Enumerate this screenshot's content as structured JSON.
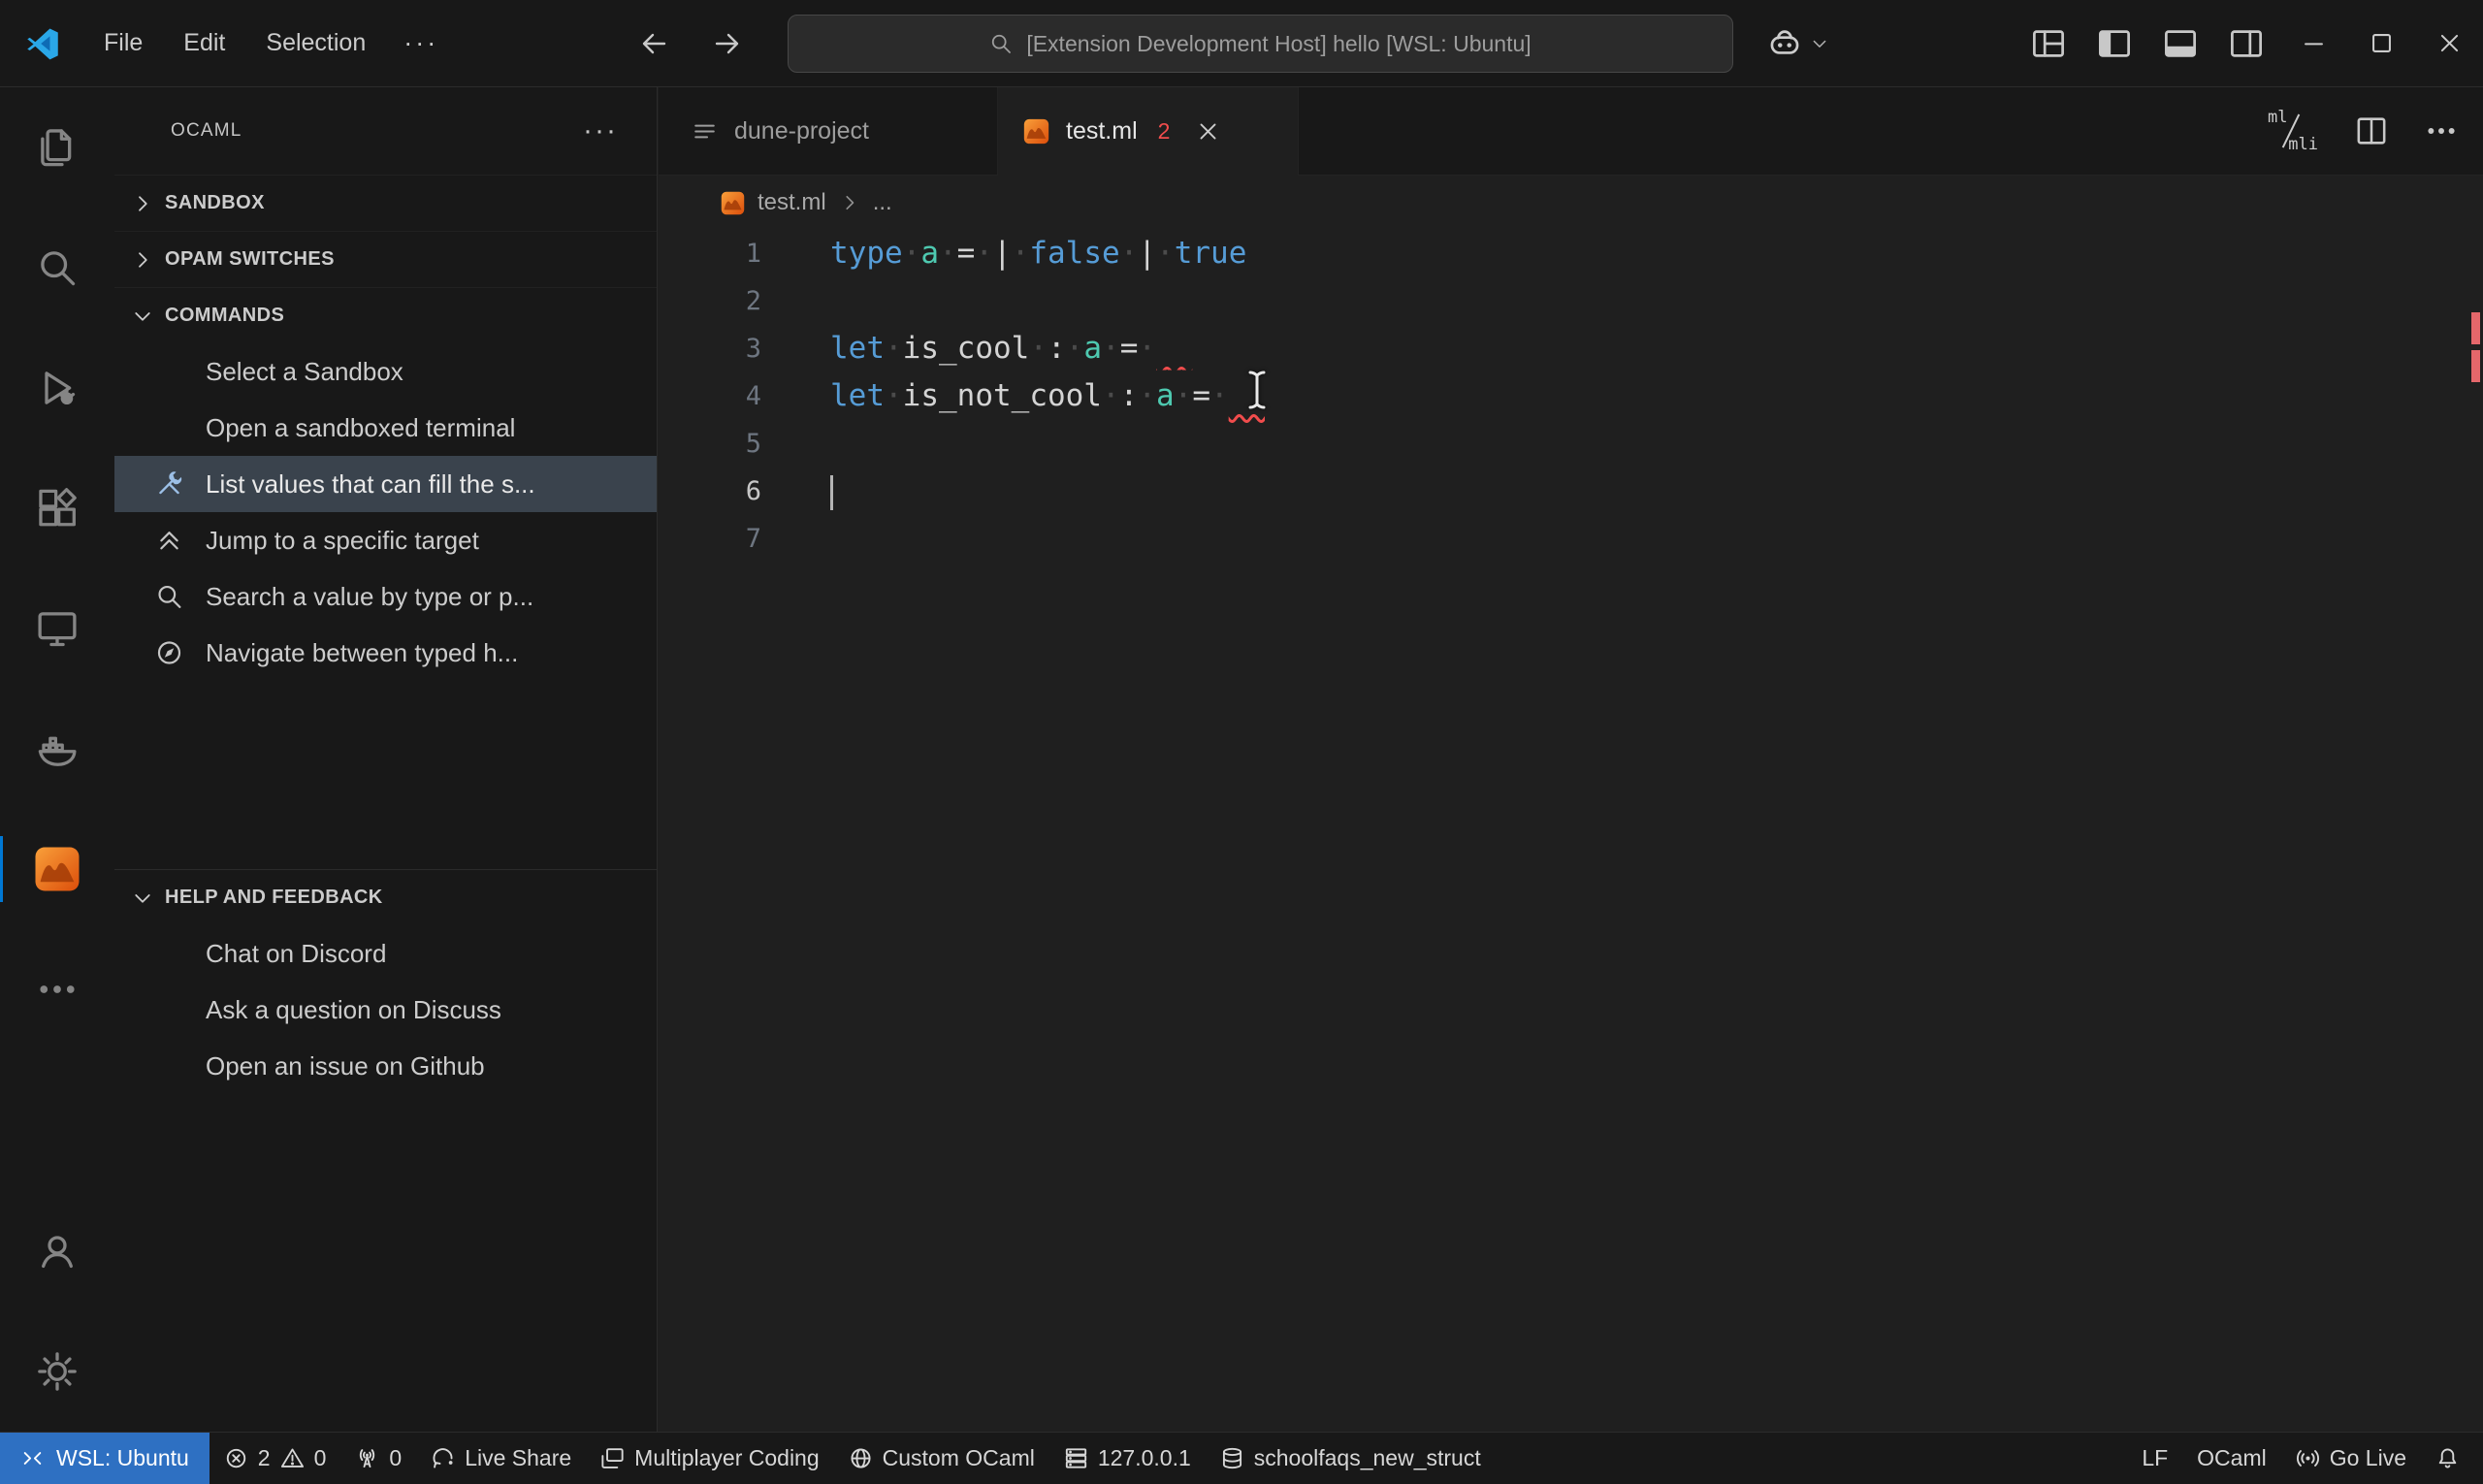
{
  "window": {
    "title": "[Extension Development Host] hello [WSL: Ubuntu]"
  },
  "title_bar": {
    "menus": [
      "File",
      "Edit",
      "Selection"
    ],
    "more_label": "···",
    "nav_icons": [
      "arrow-left",
      "arrow-right"
    ],
    "right_icons": [
      "copilot",
      "chevron-down",
      "layout",
      "layout-sidebar-left",
      "layout-panel",
      "layout-sidebar-right"
    ],
    "window_controls": [
      "minimize",
      "maximize",
      "close"
    ]
  },
  "activity_bar": {
    "top": [
      {
        "name": "explorer",
        "icon": "files"
      },
      {
        "name": "search",
        "icon": "search"
      },
      {
        "name": "run-and-debug",
        "icon": "debug"
      },
      {
        "name": "extensions",
        "icon": "extensions"
      },
      {
        "name": "remote-explorer",
        "icon": "remote-explorer"
      },
      {
        "name": "docker",
        "icon": "docker"
      },
      {
        "name": "ocaml-platform",
        "icon": "ocaml",
        "active": true
      },
      {
        "name": "more-views",
        "icon": "ellipsis"
      }
    ],
    "bottom": [
      {
        "name": "accounts",
        "icon": "account"
      },
      {
        "name": "settings",
        "icon": "gear"
      }
    ]
  },
  "sidebar": {
    "title": "OCAML",
    "actions_label": "···",
    "sections": [
      {
        "label": "SANDBOX",
        "collapsed": true
      },
      {
        "label": "OPAM SWITCHES",
        "collapsed": true
      },
      {
        "label": "COMMANDS",
        "collapsed": false,
        "items": [
          {
            "label": "Select a Sandbox"
          },
          {
            "label": "Open a sandboxed terminal"
          },
          {
            "label": "List values that can fill the s...",
            "icon": "tools",
            "selected": true
          },
          {
            "label": "Jump to a specific target",
            "icon": "fold-up"
          },
          {
            "label": "Search a value by type or p...",
            "icon": "search"
          },
          {
            "label": "Navigate between typed h...",
            "icon": "compass"
          }
        ]
      },
      {
        "label": "HELP AND FEEDBACK",
        "collapsed": false,
        "separated": true,
        "items": [
          {
            "label": "Chat on Discord"
          },
          {
            "label": "Ask a question on Discuss"
          },
          {
            "label": "Open an issue on Github"
          }
        ]
      }
    ]
  },
  "editor": {
    "tabs": [
      {
        "label": "dune-project",
        "icon": "dune",
        "active": false
      },
      {
        "label": "test.ml",
        "icon": "ocaml",
        "active": true,
        "badge": "2",
        "closable": true
      }
    ],
    "actions": [
      "ml-mli-switch",
      "split-editor",
      "more-actions"
    ],
    "ml_mli": {
      "top": "ml",
      "bottom": "mli"
    },
    "breadcrumb": {
      "file": "test.ml",
      "more": "..."
    },
    "lines": [
      {
        "num": "1",
        "tokens": [
          [
            "kw",
            "type"
          ],
          [
            "ws",
            "·"
          ],
          [
            "ty",
            "a"
          ],
          [
            "ws",
            "·"
          ],
          [
            "op",
            "="
          ],
          [
            "ws",
            "·"
          ],
          [
            "op",
            "|"
          ],
          [
            "ws",
            "·"
          ],
          [
            "kw",
            "false"
          ],
          [
            "ws",
            "·"
          ],
          [
            "op",
            "|"
          ],
          [
            "ws",
            "·"
          ],
          [
            "kw",
            "true"
          ]
        ]
      },
      {
        "num": "2",
        "tokens": []
      },
      {
        "num": "3",
        "tokens": [
          [
            "kw",
            "let"
          ],
          [
            "ws",
            "·"
          ],
          [
            "pl",
            "is_cool"
          ],
          [
            "ws",
            "·"
          ],
          [
            "op",
            ":"
          ],
          [
            "ws",
            "·"
          ],
          [
            "ty",
            "a"
          ],
          [
            "ws",
            "·"
          ],
          [
            "op",
            "="
          ],
          [
            "ws",
            "·"
          ],
          [
            "err",
            ""
          ]
        ]
      },
      {
        "num": "4",
        "tokens": [
          [
            "kw",
            "let"
          ],
          [
            "ws",
            "·"
          ],
          [
            "pl",
            "is_not_cool"
          ],
          [
            "ws",
            "·"
          ],
          [
            "op",
            ":"
          ],
          [
            "ws",
            "·"
          ],
          [
            "ty",
            "a"
          ],
          [
            "ws",
            "·"
          ],
          [
            "op",
            "="
          ],
          [
            "ws",
            "·"
          ],
          [
            "err",
            ""
          ]
        ]
      },
      {
        "num": "5",
        "tokens": []
      },
      {
        "num": "6",
        "tokens": [],
        "caret": true,
        "active": true
      },
      {
        "num": "7",
        "tokens": []
      }
    ]
  },
  "status_bar": {
    "left": [
      {
        "name": "remote",
        "accent": true,
        "parts": [
          {
            "icon": "remote"
          },
          {
            "text": "WSL: Ubuntu"
          }
        ]
      },
      {
        "name": "problems",
        "parts": [
          {
            "icon": "error"
          },
          {
            "text": "2"
          },
          {
            "icon": "warning"
          },
          {
            "text": "0"
          }
        ]
      },
      {
        "name": "ports",
        "parts": [
          {
            "icon": "radio-tower"
          },
          {
            "text": "0"
          }
        ]
      },
      {
        "name": "live-share",
        "parts": [
          {
            "icon": "live-share"
          },
          {
            "text": "Live Share"
          }
        ]
      },
      {
        "name": "multiplayer-coding",
        "parts": [
          {
            "icon": "window"
          },
          {
            "text": "Multiplayer Coding"
          }
        ]
      },
      {
        "name": "custom-ocaml",
        "parts": [
          {
            "icon": "globe"
          },
          {
            "text": "Custom OCaml"
          }
        ]
      },
      {
        "name": "server-address",
        "parts": [
          {
            "icon": "server"
          },
          {
            "text": "127.0.0.1"
          }
        ]
      },
      {
        "name": "database",
        "parts": [
          {
            "icon": "database"
          },
          {
            "text": "schoolfaqs_new_struct"
          }
        ]
      }
    ],
    "right": [
      {
        "name": "eol",
        "parts": [
          {
            "text": "LF"
          }
        ]
      },
      {
        "name": "language-mode",
        "parts": [
          {
            "text": "OCaml"
          }
        ]
      },
      {
        "name": "go-live",
        "parts": [
          {
            "icon": "broadcast"
          },
          {
            "text": "Go Live"
          }
        ]
      },
      {
        "name": "notifications",
        "parts": [
          {
            "icon": "bell"
          }
        ]
      }
    ]
  },
  "colors": {
    "accent": "#0078d4",
    "remote_bg": "#2e70c2",
    "error": "#f14c4c",
    "keyword": "#569cd6",
    "type": "#4ec9b0"
  }
}
